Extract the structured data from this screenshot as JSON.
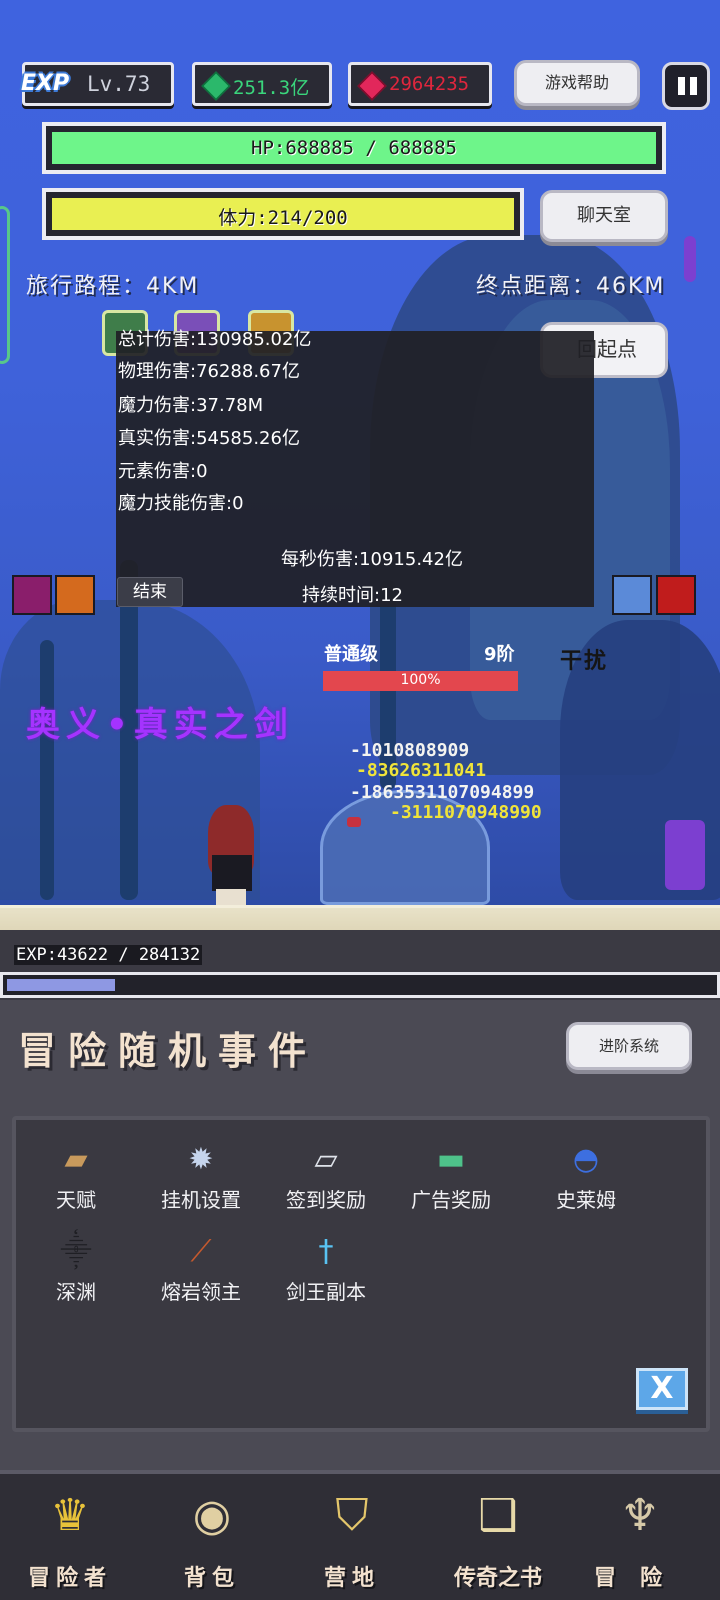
{
  "hud": {
    "exp_badge": "EXP",
    "level": "Lv.73",
    "gems": "251.3亿",
    "rubies": "2964235",
    "help_label": "游戏帮助",
    "hp_text": "HP:688885 / 688885",
    "hp_fill": 1.0,
    "stamina_text": "体力:214/200",
    "stamina_fill": 1.0,
    "chat_label": "聊天室",
    "travel_text": "旅行路程：4KM",
    "end_dist_text": "终点距离：46KM",
    "return_label": "回起点"
  },
  "damage_panel": {
    "lines": [
      "总计伤害:130985.02亿",
      "物理伤害:76288.67亿",
      "魔力伤害:37.78M",
      "真实伤害:54585.26亿",
      "元素伤害:0",
      "魔力技能伤害:0"
    ],
    "dps": "每秒伤害:10915.42亿",
    "duration": "持续时间:12",
    "end_label": "结束"
  },
  "enemy": {
    "rank": "普通级",
    "tier": "9阶",
    "hp_percent": "100%",
    "hp_fill": 1.0,
    "status": "干扰"
  },
  "skill_banner": "奥义•真实之剑",
  "damage_numbers": [
    "-1010808909",
    "-83626311041",
    "-1863531107094899",
    "-3111070948990"
  ],
  "exp": {
    "text": "EXP:43622 / 284132",
    "fill": 0.1535
  },
  "event_panel": {
    "title": "冒险随机事件",
    "advance_label": "进阶系统",
    "close_label": "X",
    "items": [
      {
        "label": "天赋",
        "icon": "book-icon"
      },
      {
        "label": "挂机设置",
        "icon": "gear-icon"
      },
      {
        "label": "签到奖励",
        "icon": "scroll-icon"
      },
      {
        "label": "广告奖励",
        "icon": "chest-icon"
      },
      {
        "label": "史莱姆",
        "icon": "slime-icon"
      },
      {
        "label": "深渊",
        "icon": "crow-icon"
      },
      {
        "label": "熔岩领主",
        "icon": "sword-icon"
      },
      {
        "label": "剑王副本",
        "icon": "blue-sword-icon"
      }
    ]
  },
  "nav": [
    {
      "label": "冒险者",
      "icon": "helmet-icon"
    },
    {
      "label": "背包",
      "icon": "bag-icon"
    },
    {
      "label": "营地",
      "icon": "camp-icon"
    },
    {
      "label": "传奇之书",
      "icon": "legend-book-icon"
    },
    {
      "label": "冒险",
      "icon": "adventure-sword-icon"
    }
  ],
  "colors": {
    "hp": "#6ef58a",
    "stamina": "#e9ef52",
    "gem_text": "#3ad57c",
    "ruby_text": "#e0263d",
    "skill_banner": "#a533ff",
    "enemy_hp": "#e3474e",
    "exp_fill": "#8e98e3"
  }
}
